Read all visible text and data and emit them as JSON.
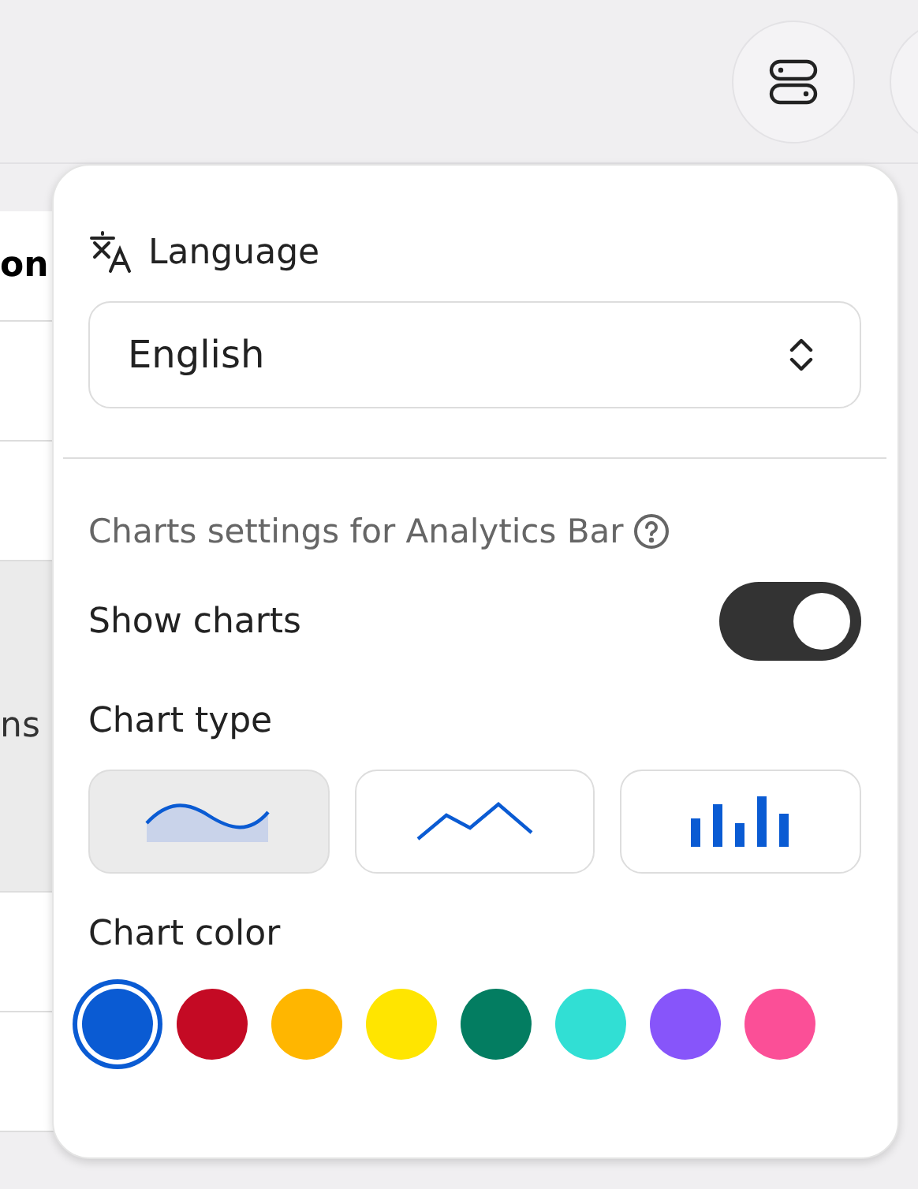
{
  "background": {
    "snippets": [
      {
        "kind": "bold",
        "text": "on"
      },
      {
        "kind": "plain",
        "text": "ns"
      }
    ]
  },
  "popover": {
    "language": {
      "label": "Language",
      "value": "English"
    },
    "charts_section": {
      "title": "Charts settings for Analytics Bar",
      "show_charts": {
        "label": "Show charts",
        "on": true
      },
      "chart_type": {
        "label": "Chart type",
        "options": [
          {
            "kind": "area",
            "selected": true
          },
          {
            "kind": "line",
            "selected": false
          },
          {
            "kind": "bar",
            "selected": false
          }
        ]
      },
      "chart_color": {
        "label": "Chart color",
        "swatches": [
          {
            "color": "#0a5bd3",
            "selected": true
          },
          {
            "color": "#c40a24",
            "selected": false
          },
          {
            "color": "#ffb600",
            "selected": false
          },
          {
            "color": "#ffe500",
            "selected": false
          },
          {
            "color": "#037d61",
            "selected": false
          },
          {
            "color": "#31dfd4",
            "selected": false
          },
          {
            "color": "#8755fa",
            "selected": false
          },
          {
            "color": "#fb4f97",
            "selected": false
          }
        ]
      }
    }
  }
}
